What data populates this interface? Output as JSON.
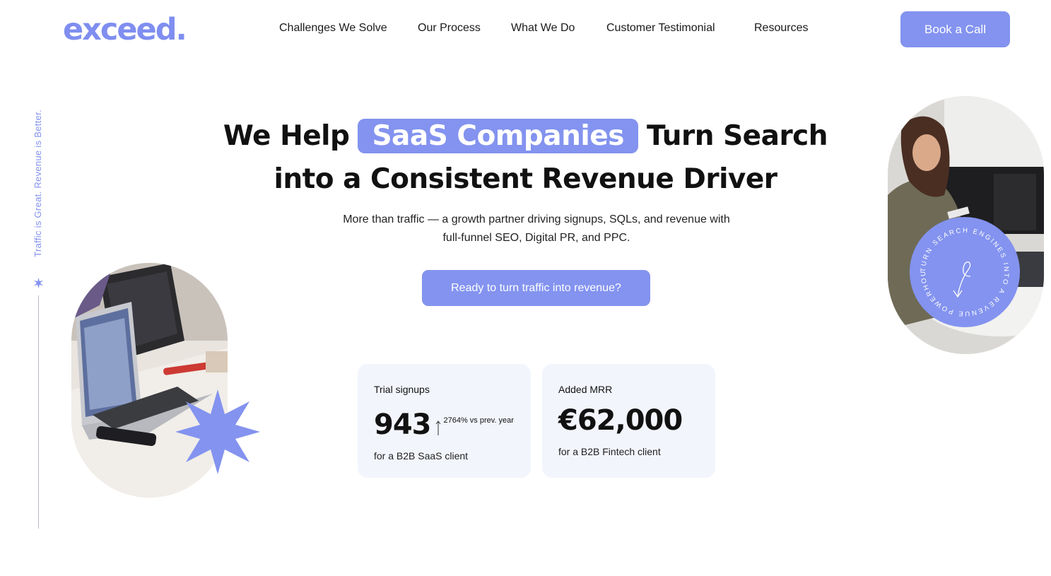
{
  "brand": {
    "logo": "exceed.",
    "accent": "#8393ef"
  },
  "nav": {
    "items": [
      "Challenges We Solve",
      "Our Process",
      "What We Do",
      "Customer Testimonial",
      "Resources"
    ],
    "cta": "Book a Call"
  },
  "side": {
    "tagline": "Traffic is Great. Revenue is Better."
  },
  "hero": {
    "title_pre": "We Help",
    "title_highlight": "SaaS Companies",
    "title_post": "Turn Search",
    "title_line2": "into a Consistent Revenue Driver",
    "subtitle_line1": "More than traffic — a growth partner driving signups, SQLs, and revenue with",
    "subtitle_line2": "full-funnel SEO, Digital PR, and PPC.",
    "cta": "Ready to turn traffic into revenue?"
  },
  "stats": [
    {
      "label": "Trial signups",
      "value": "943",
      "delta": "2764% vs prev. year",
      "desc": "for a B2B SaaS client"
    },
    {
      "label": "Added MRR",
      "value": "€62,000",
      "desc": "for a B2B Fintech client"
    }
  ],
  "badge": {
    "text": "TURN SEARCH ENGINES INTO A REVENUE POWERHOUSE."
  }
}
